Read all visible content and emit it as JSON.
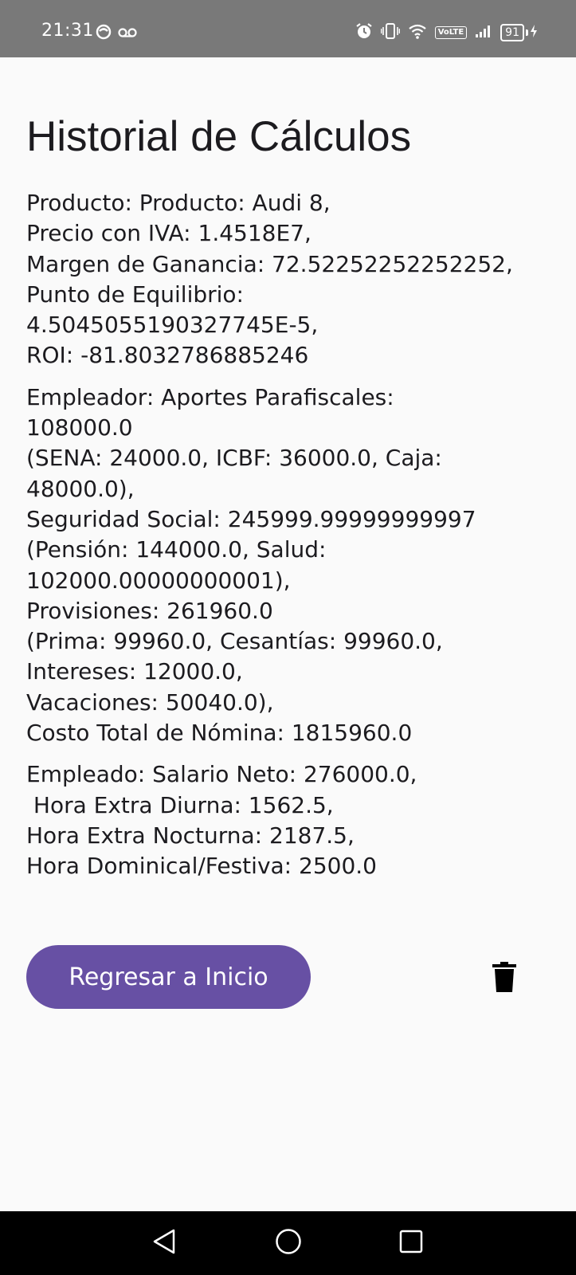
{
  "status_bar": {
    "time": "21:31",
    "volte": "VoLTE",
    "battery_level": "91"
  },
  "page": {
    "title": "Historial de Cálculos"
  },
  "history": [
    {
      "lines": [
        "Producto: Producto: Audi 8,",
        "Precio con IVA: 1.4518E7,",
        "Margen de Ganancia: 72.52252252252252,",
        "Punto de Equilibrio:",
        "4.5045055190327745E-5,",
        "ROI: -81.8032786885246"
      ]
    },
    {
      "lines": [
        "Empleador: Aportes Parafiscales:",
        "108000.0",
        "(SENA: 24000.0, ICBF: 36000.0, Caja:",
        "48000.0),",
        "Seguridad Social: 245999.99999999997",
        "(Pensión: 144000.0, Salud:",
        "102000.00000000001),",
        "Provisiones: 261960.0",
        "(Prima: 99960.0, Cesantías: 99960.0,",
        "Intereses: 12000.0,",
        "Vacaciones: 50040.0),",
        "Costo Total de Nómina: 1815960.0"
      ]
    },
    {
      "lines": [
        "Empleado: Salario Neto: 276000.0,",
        " Hora Extra Diurna: 1562.5,",
        "Hora Extra Nocturna: 2187.5,",
        "Hora Dominical/Festiva: 2500.0"
      ]
    }
  ],
  "actions": {
    "back_label": "Regresar a Inicio",
    "delete_icon": "trash-icon"
  },
  "colors": {
    "primary": "#6750a4",
    "status_bar": "#797979",
    "background": "#fafafa"
  }
}
